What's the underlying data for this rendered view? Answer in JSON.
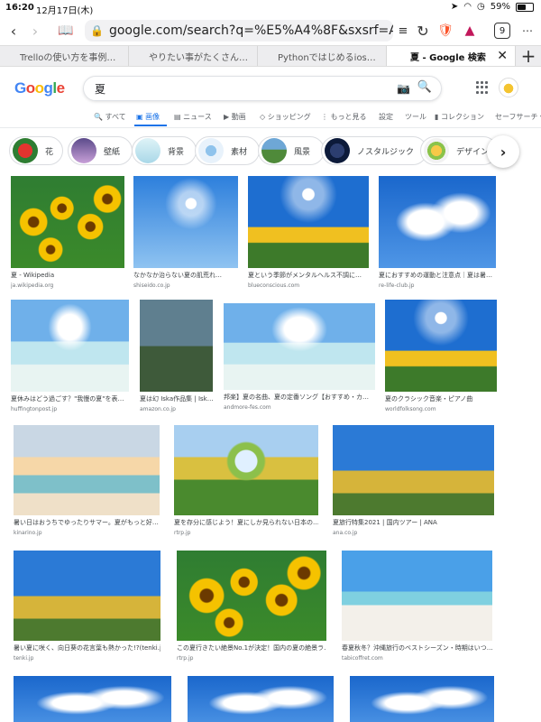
{
  "status": {
    "time": "16:20",
    "date": "12月17日(木)",
    "battery": "59%",
    "battery_level": 0.59
  },
  "browser": {
    "url": "google.com/search?q=%E5%A4%8F&sxsrf=ALeKk0...",
    "tab_count": "9",
    "tabs": [
      {
        "label": "Trelloの使い方を事例…"
      },
      {
        "label": "やりたい事がたくさん…"
      },
      {
        "label": "Pythonではじめるios…"
      },
      {
        "label": "夏 - Google 検索"
      }
    ]
  },
  "search": {
    "logo": "Google",
    "query": "夏",
    "tabs": [
      {
        "label": "すべて"
      },
      {
        "label": "画像"
      },
      {
        "label": "ニュース"
      },
      {
        "label": "動画"
      },
      {
        "label": "ショッピング"
      },
      {
        "label": "もっと見る"
      },
      {
        "label": "設定"
      },
      {
        "label": "ツール"
      },
      {
        "label": "コレクション"
      },
      {
        "label": "セーフサーチ ▾"
      }
    ],
    "chips": [
      {
        "label": "花"
      },
      {
        "label": "壁紙"
      },
      {
        "label": "背景"
      },
      {
        "label": "素材"
      },
      {
        "label": "風景"
      },
      {
        "label": "ノスタルジック"
      },
      {
        "label": "デザイン"
      }
    ]
  },
  "results": [
    {
      "title": "夏 - Wikipedia",
      "source": "ja.wikipedia.org"
    },
    {
      "title": "なかなか治らない夏の肌荒れ…",
      "source": "shiseido.co.jp"
    },
    {
      "title": "夏という季節がメンタルヘルス不調に…",
      "source": "blueconscious.com"
    },
    {
      "title": "夏におすすめの運動と注意点｜夏は暑…",
      "source": "re-life-club.jp"
    },
    {
      "title": "夏休みはどう過ごす？\"我慢の夏\"を表…",
      "source": "huffingtonpost.jp"
    },
    {
      "title": "夏は幻 Iska作品集 | Isk…",
      "source": "amazon.co.jp"
    },
    {
      "title": "邦楽】夏の名曲、夏の定番ソング【おすすめ・カ…",
      "source": "andmore-fes.com"
    },
    {
      "title": "夏のクラシック音楽・ピアノ曲",
      "source": "worldfolksong.com"
    },
    {
      "title": "暑い日はおうちでゆったりサマー。夏がもっと好…",
      "source": "kinarino.jp"
    },
    {
      "title": "夏を存分に感じよう！夏にしか見られない日本の…",
      "source": "rtrp.jp"
    },
    {
      "title": "夏旅行特集2021 | 国内ツアー | ANA",
      "source": "ana.co.jp"
    },
    {
      "title": "暑い夏に咲く、向日葵の花言葉も熱かった!?(tenki.j…",
      "source": "tenki.jp"
    },
    {
      "title": "この夏行きたい絶景No.1が決定！国内の夏の絶景ラ…",
      "source": "rtrp.jp"
    },
    {
      "title": "春夏秋冬？沖縄旅行のベストシーズン・時期はいつ…",
      "source": "tabicoffret.com"
    }
  ]
}
